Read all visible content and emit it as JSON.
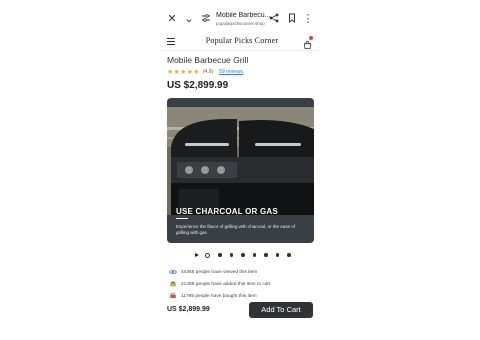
{
  "browser": {
    "tab_title": "Mobile Barbecu...",
    "url": "popularpickscorner.shop",
    "icons": [
      "close-icon",
      "chevron-down-icon",
      "tune-icon",
      "share-icon",
      "bookmark-icon",
      "more-vert-icon"
    ]
  },
  "store": {
    "logo_text": "Popular Picks Corner",
    "icons": [
      "menu-icon",
      "cart-icon"
    ],
    "cart_badge_color": "#e0463a"
  },
  "product": {
    "title": "Mobile Barbecue Grill",
    "stars": "★★★★★",
    "rating": "(4.9)",
    "reviews": "59 reviews",
    "price": "US $2,899.99"
  },
  "slide": {
    "heading": "USE CHARCOAL OR GAS",
    "description": "Experience the flavor of grilling with charcoal, or the ease of grilling with gas",
    "card_color": "#3a3f45"
  },
  "carousel": {
    "dot_count": 8,
    "active_index": 0
  },
  "proof": [
    {
      "icon": "eye-icon",
      "text": "44365 people have viewed this item"
    },
    {
      "icon": "cart-add-icon",
      "text": "21459 people have added this item to cart"
    },
    {
      "icon": "bag-icon",
      "text": "11795 people have bought this item"
    }
  ],
  "footer": {
    "price": "US $2,899.99",
    "add_to_cart": "Add To Cart",
    "button_color": "#2f3338"
  }
}
